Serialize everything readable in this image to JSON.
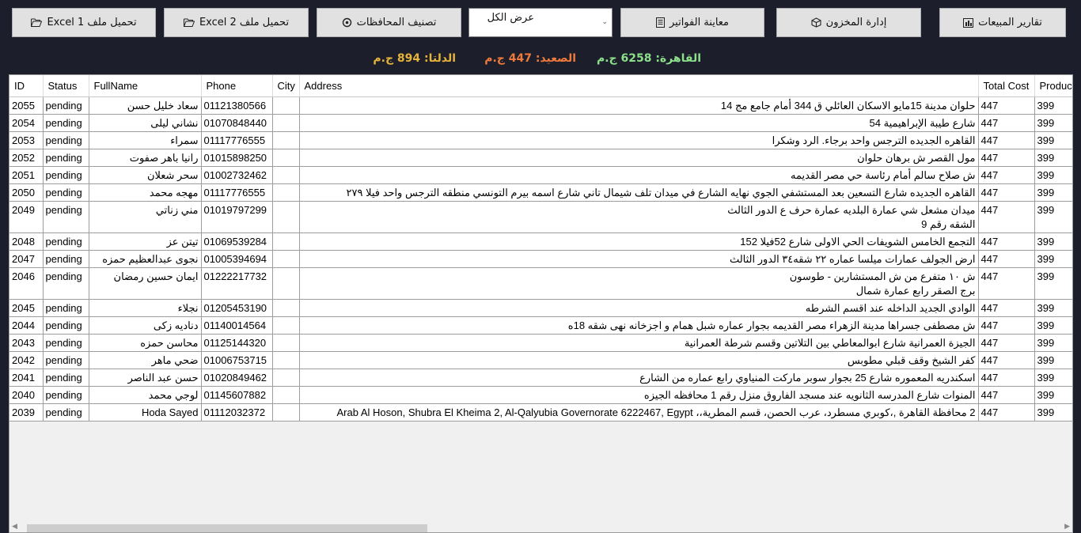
{
  "toolbar": {
    "sales_reports": "تقارير المبيعات",
    "inventory": "إدارة المخزون",
    "invoice_preview": "معاينة الفواتير",
    "filter_selected": "عرض الكل",
    "classify_governorates": "تصنيف المحافظات",
    "upload_excel2": "تحميل ملف Excel 2",
    "upload_excel1": "تحميل ملف Excel 1"
  },
  "totals": {
    "cairo": "القاهرة: 6258 ج.م",
    "saeed": "الصعيد: 447 ج.م",
    "delta": "الدلتا: 894 ج.م"
  },
  "colors": {
    "cairo": "#8de08a",
    "saeed": "#f07a3c",
    "delta": "#e6b43a"
  },
  "icons": {
    "sales_reports": "bar-chart-icon",
    "inventory": "box-icon",
    "invoice_preview": "document-icon",
    "classify_governorates": "gear-icon",
    "upload_excel": "folder-open-icon"
  },
  "table": {
    "columns": [
      "ID",
      "Status",
      "FullName",
      "Phone",
      "City",
      "Address",
      "Total Cost",
      "Produc"
    ],
    "rows": [
      {
        "id": "2055",
        "status": "pending",
        "name": "سعاد خليل حسن",
        "phone": "01121380566",
        "city": "",
        "address": "حلوان مدينة 15مايو الاسكان العائلي ق 344 أمام جامع مج 14",
        "total": "447",
        "product": "399"
      },
      {
        "id": "2054",
        "status": "pending",
        "name": "نشاني ليلى",
        "phone": "01070848440",
        "city": "",
        "address": "شارع طيبة الإبراهيمية 54",
        "total": "447",
        "product": "399"
      },
      {
        "id": "2053",
        "status": "pending",
        "name": "سمراء",
        "phone": "01117776555",
        "city": "",
        "address": "القاهره الجديده  الترجس  واحد  برجاء. الرد  وشكرا",
        "total": "447",
        "product": "399"
      },
      {
        "id": "2052",
        "status": "pending",
        "name": "رانيا باهر صفوت",
        "phone": "01015898250",
        "city": "",
        "address": "مول القصر ش برهان حلوان",
        "total": "447",
        "product": "399"
      },
      {
        "id": "2051",
        "status": "pending",
        "name": "سحر شعلان",
        "phone": "01002732462",
        "city": "",
        "address": "ش صلاح سالم أمام رئاسة حي مصر القديمه",
        "total": "447",
        "product": "399"
      },
      {
        "id": "2050",
        "status": "pending",
        "name": "مهجه محمد",
        "phone": "01117776555",
        "city": "",
        "address": "القاهره الجديده  شارع التسعين بعد المستشفي الجوي نهايه الشارع في ميدان تلف شيمال  تاني شارع  اسمه بيرم التونسي  منطقه الترجس واحد فيلا ٢٧٩",
        "total": "447",
        "product": "399"
      },
      {
        "id": "2049",
        "status": "pending",
        "name": "مني زناتي",
        "phone": "01019797299",
        "city": "",
        "address": "ميدان مشعل شي عمارة البلديه عمارة حرف ع الدور الثالث\nالشقه رقم 9",
        "total": "447",
        "product": "399"
      },
      {
        "id": "2048",
        "status": "pending",
        "name": "تيتن عز",
        "phone": "01069539284",
        "city": "",
        "address": "التجمع الخامس الشويفات الحي الاولى شارع 52فيلا 152",
        "total": "447",
        "product": "399"
      },
      {
        "id": "2047",
        "status": "pending",
        "name": "نجوى  عبدالعظيم حمزه",
        "phone": "01005394694",
        "city": "",
        "address": "ارض الجولف عمارات ميلسا عماره ٢٢  شقه٣٤ الدور الثالث",
        "total": "447",
        "product": "399"
      },
      {
        "id": "2046",
        "status": "pending",
        "name": "ايمان حسين رمضان",
        "phone": "01222217732",
        "city": "",
        "address": "ش ١٠ متفرع من ش المستشارين  -  طوسون\nبرج الصقر رابع عمارة شمال",
        "total": "447",
        "product": "399"
      },
      {
        "id": "2045",
        "status": "pending",
        "name": "نجلاء",
        "phone": "01205453190",
        "city": "",
        "address": "الوادي الجديد الداخله عند اقسم الشرطه",
        "total": "447",
        "product": "399"
      },
      {
        "id": "2044",
        "status": "pending",
        "name": "دناديه زكى",
        "phone": "01140014564",
        "city": "",
        "address": "ش مصطفى جسراها مدينة الزهراء مصر القديمه بجوار عماره شبل همام و اجزخانه نهى شقه 18ه",
        "total": "447",
        "product": "399"
      },
      {
        "id": "2043",
        "status": "pending",
        "name": "محاسن حمزه",
        "phone": "01125144320",
        "city": "",
        "address": "الجيزة العمرانية شارع ابوالمعاطي بين التلاتين وقسم  شرطة  العمرانية",
        "total": "447",
        "product": "399"
      },
      {
        "id": "2042",
        "status": "pending",
        "name": "ضحي ماهر",
        "phone": "01006753715",
        "city": "",
        "address": "كفر الشيخ وقف قبلي مطوبس",
        "total": "447",
        "product": "399"
      },
      {
        "id": "2041",
        "status": "pending",
        "name": "حسن عبد الناصر",
        "phone": "01020849462",
        "city": "",
        "address": "اسكندريه المعموره شارع 25 بجوار سوبر ماركت المنياوي رابع عماره من الشارع",
        "total": "447",
        "product": "399"
      },
      {
        "id": "2040",
        "status": "pending",
        "name": "لوجي محمد",
        "phone": "01145607882",
        "city": "",
        "address": "المنوات شارع المدرسه الثانويه عند مسجد الفاروق منزل رقم 1 محافظه الجيزه",
        "total": "447",
        "product": "399"
      },
      {
        "id": "2039",
        "status": "pending",
        "name": "Hoda Sayed",
        "phone": "01112032372",
        "city": "",
        "address": "2 محافظة القاهرة ,،كوبري مسطرد، عرب الحصن، قسم المطرية،، Arab Al Hoson, Shubra El Kheima 2, Al-Qalyubia Governorate 6222467, Egypt",
        "total": "447",
        "product": "399"
      }
    ]
  }
}
